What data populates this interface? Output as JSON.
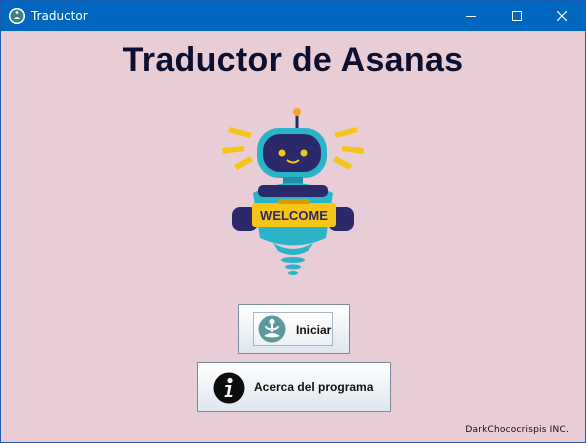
{
  "window": {
    "title": "Traductor",
    "colors": {
      "titlebar": "#0067c0",
      "background": "#e8cdd6"
    }
  },
  "main": {
    "heading": "Traductor de Asanas",
    "illustration": {
      "sign_text": "WELCOME"
    }
  },
  "buttons": {
    "start": {
      "label": "Iniciar",
      "icon": "meditation-icon"
    },
    "about": {
      "label": "Acerca del programa",
      "icon": "info-icon"
    }
  },
  "footer": {
    "credits": "DarkChococrispis INC."
  }
}
